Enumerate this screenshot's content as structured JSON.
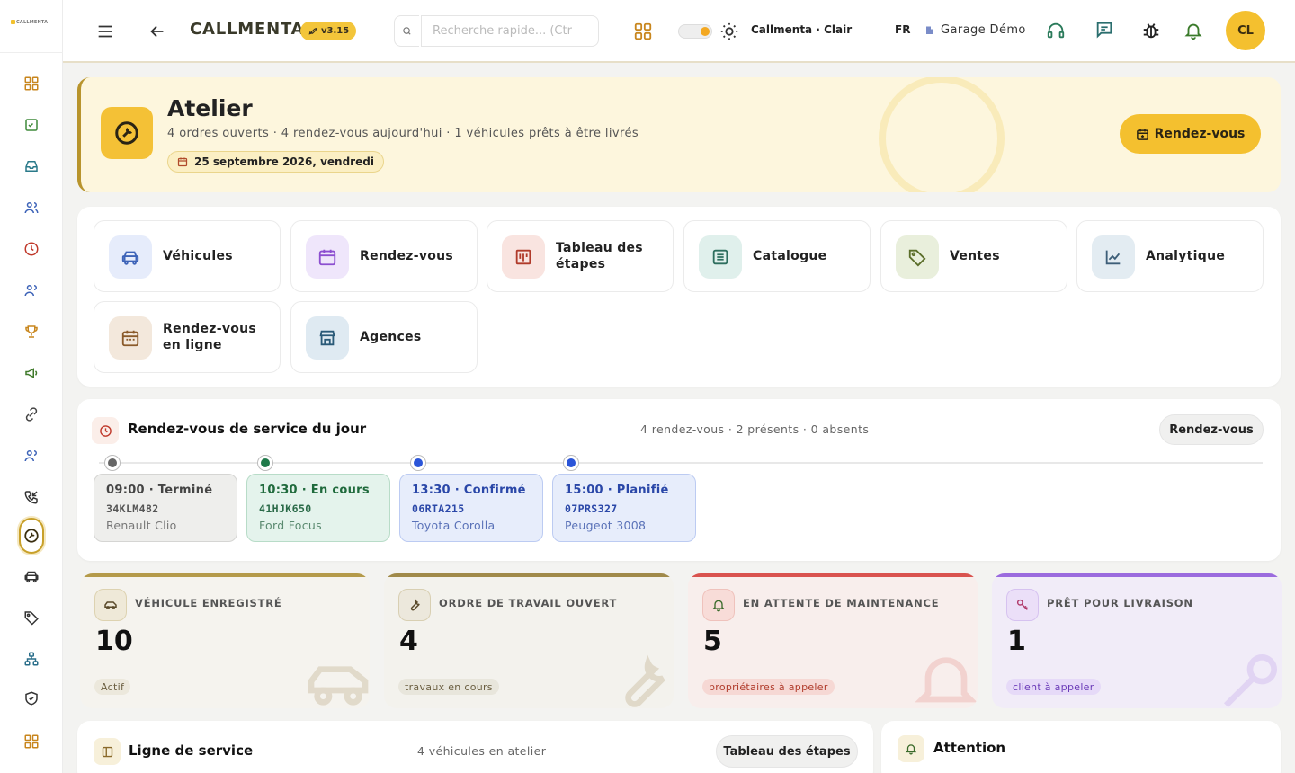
{
  "app": {
    "logo_text": "CALLMENTA",
    "brand": "CALLMENTA",
    "version": "v3.15"
  },
  "topbar": {
    "search_placeholder": "Recherche rapide... (Ctr",
    "theme_label": "Callmenta · Clair",
    "language": "FR",
    "garage": "Garage Démo",
    "avatar_initials": "CL"
  },
  "hero": {
    "title": "Atelier",
    "subtitle": "4 ordres ouverts · 4 rendez-vous aujourd'hui · 1 véhicules prêts à être livrés",
    "date": "25 septembre 2026, vendredi",
    "button": "Rendez-vous"
  },
  "quick_access": [
    {
      "label": "Véhicules",
      "icon": "car-icon",
      "color": "#3d63b8",
      "bg": "#e6ecfb"
    },
    {
      "label": "Rendez-vous",
      "icon": "calendar-icon",
      "color": "#8c4fd0",
      "bg": "#efe6fb"
    },
    {
      "label": "Tableau des étapes",
      "icon": "kanban-icon",
      "color": "#b03a2a",
      "bg": "#f9e4e0"
    },
    {
      "label": "Catalogue",
      "icon": "list-icon",
      "color": "#2d6e5e",
      "bg": "#e0f0ec"
    },
    {
      "label": "Ventes",
      "icon": "tag-icon",
      "color": "#5b6e2a",
      "bg": "#e9efdc"
    },
    {
      "label": "Analytique",
      "icon": "chart-icon",
      "color": "#3d5e78",
      "bg": "#e3ecf2"
    },
    {
      "label": "Rendez-vous en ligne",
      "icon": "calendar-online-icon",
      "color": "#8a5a2a",
      "bg": "#f3e8dc"
    },
    {
      "label": "Agences",
      "icon": "store-icon",
      "color": "#2a5a78",
      "bg": "#dfeaf2"
    }
  ],
  "appointments": {
    "title": "Rendez-vous de service du jour",
    "stats": "4 rendez-vous · 2 présents · 0 absents",
    "button": "Rendez-vous",
    "items": [
      {
        "header": "09:00 · Terminé",
        "plate": "34KLM482",
        "model": "Renault Clio",
        "status": "done"
      },
      {
        "header": "10:30 · En cours",
        "plate": "41HJK650",
        "model": "Ford Focus",
        "status": "in-progress"
      },
      {
        "header": "13:30 · Confirmé",
        "plate": "06RTA215",
        "model": "Toyota Corolla",
        "status": "confirmed"
      },
      {
        "header": "15:00 · Planifié",
        "plate": "07PRS327",
        "model": "Peugeot 3008",
        "status": "planned"
      }
    ]
  },
  "kpis": [
    {
      "label": "VÉHICULE ENREGISTRÉ",
      "value": "10",
      "tag": "Actif",
      "accent": "#b49a4a",
      "icon": "car-outline-icon"
    },
    {
      "label": "ORDRE DE TRAVAIL OUVERT",
      "value": "4",
      "tag": "travaux en cours",
      "accent": "#a08a4a",
      "icon": "wrench-icon"
    },
    {
      "label": "EN ATTENTE DE MAINTENANCE",
      "value": "5",
      "tag": "propriétaires à appeler",
      "accent": "#d9534f",
      "icon": "bell-icon"
    },
    {
      "label": "PRÊT POUR LIVRAISON",
      "value": "1",
      "tag": "client à appeler",
      "accent": "#9b6bde",
      "icon": "key-icon"
    }
  ],
  "service_line": {
    "title": "Ligne de service",
    "stats": "4 véhicules en atelier",
    "button": "Tableau des étapes"
  },
  "attention": {
    "title": "Attention"
  }
}
